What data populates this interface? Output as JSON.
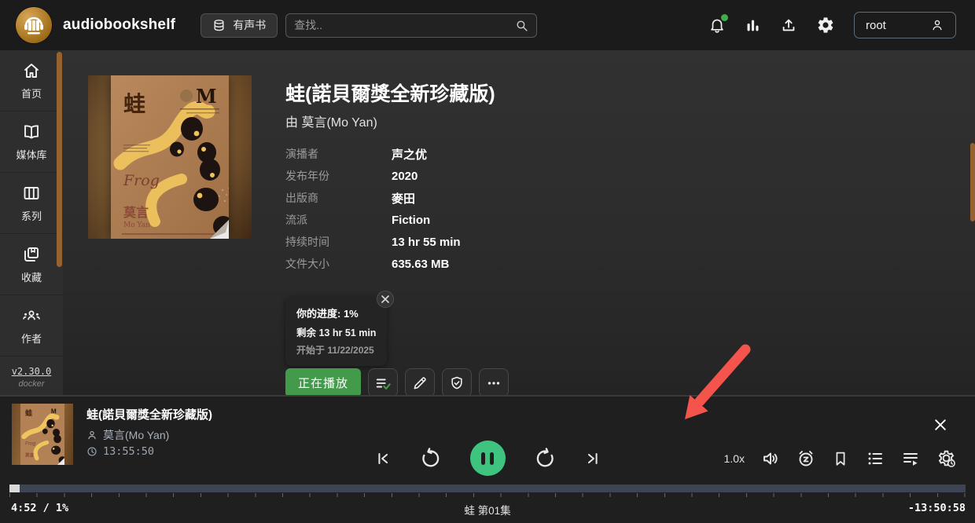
{
  "appbar": {
    "title": "audiobookshelf",
    "library_button_label": "有声书",
    "search_placeholder": "查找..",
    "user_label": "root"
  },
  "sidebar": {
    "items": [
      {
        "label": "首页"
      },
      {
        "label": "媒体库"
      },
      {
        "label": "系列"
      },
      {
        "label": "收藏"
      },
      {
        "label": "作者"
      }
    ],
    "version": "v2.30.0",
    "platform": "docker"
  },
  "book": {
    "title": "蛙(諾貝爾獎全新珍藏版)",
    "author_prefix": "由",
    "author": "莫言(Mo Yan)",
    "metadata": [
      {
        "label": "演播者",
        "value": "声之优"
      },
      {
        "label": "发布年份",
        "value": "2020"
      },
      {
        "label": "出版商",
        "value": "麥田"
      },
      {
        "label": "流派",
        "value": "Fiction"
      },
      {
        "label": "持续时间",
        "value": "13 hr 55 min"
      },
      {
        "label": "文件大小",
        "value": "635.63 MB"
      }
    ],
    "progress_card": {
      "progress_line": "你的进度: 1%",
      "remaining_line": "剩余 13 hr 51 min",
      "started_line": "开始于 11/22/2025"
    },
    "actions": {
      "playing_label": "正在播放"
    }
  },
  "cover": {
    "title_char": "蛙",
    "english_title": "Frog",
    "author_cn": "莫言",
    "author_en": "Mo Yan",
    "publisher_mark": "M"
  },
  "player": {
    "title": "蛙(諾貝爾獎全新珍藏版)",
    "author": "莫言(Mo Yan)",
    "total_duration": "13:55:50",
    "playback_speed": "1.0x",
    "elapsed": "4:52 / 1%",
    "chapter": "蛙 第01集",
    "remaining": "-13:50:58",
    "progress_percent": 1
  },
  "colors": {
    "button_green": "#449a4b",
    "pause_green": "#3ec47f",
    "check_green": "#43a047",
    "notification_green": "#3fae4a",
    "scrollbar_amber": "#96622f",
    "arrow_red": "#f4544c",
    "seek_track": "#3d4453"
  }
}
